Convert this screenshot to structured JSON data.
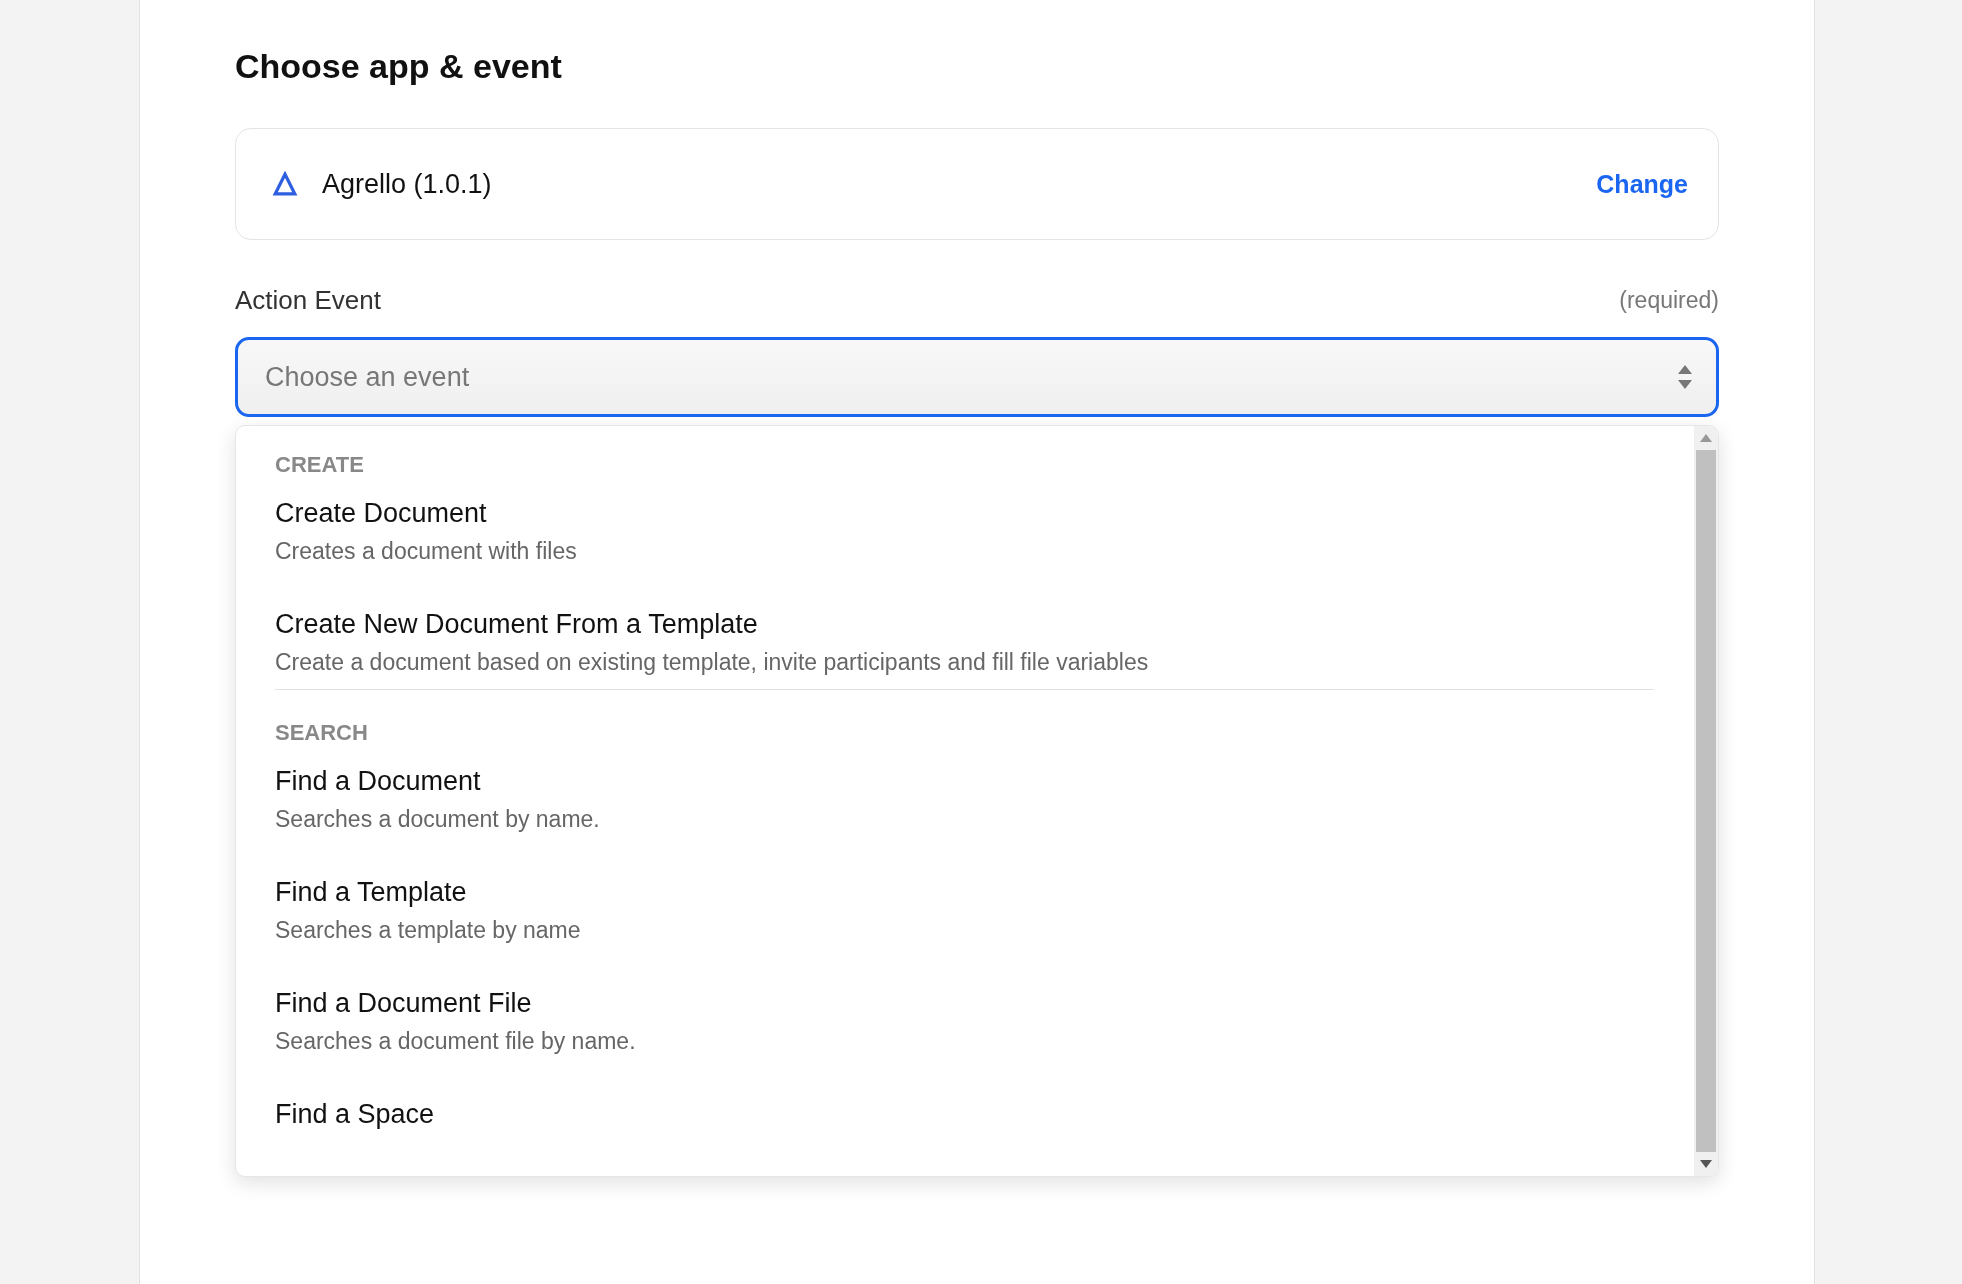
{
  "heading": "Choose app & event",
  "app": {
    "name": "Agrello (1.0.1)",
    "action": "Change"
  },
  "field": {
    "label": "Action Event",
    "note": "(required)",
    "placeholder": "Choose an event",
    "focused": true
  },
  "groups": [
    {
      "title": "CREATE",
      "items": [
        {
          "title": "Create Document",
          "description": "Creates a document with files"
        },
        {
          "title": "Create New Document From a Template",
          "description": "Create a document based on existing template, invite participants and fill file variables"
        }
      ]
    },
    {
      "title": "SEARCH",
      "items": [
        {
          "title": "Find a Document",
          "description": "Searches a document by name."
        },
        {
          "title": "Find a Template",
          "description": "Searches a template by name"
        },
        {
          "title": "Find a Document File",
          "description": "Searches a document file by name."
        },
        {
          "title": "Find a Space"
        }
      ]
    }
  ]
}
